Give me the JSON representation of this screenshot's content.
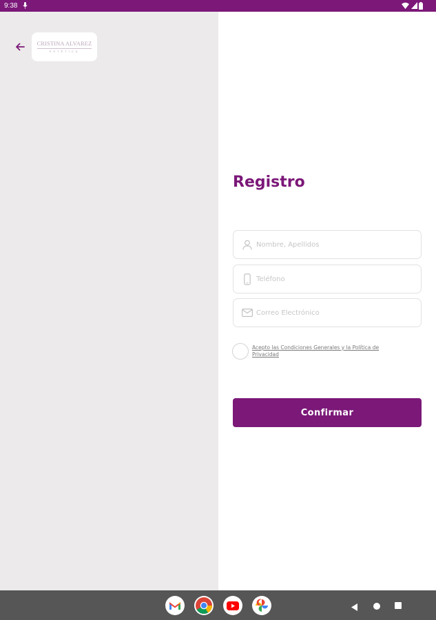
{
  "status_bar": {
    "time": "9:38",
    "icons": [
      "mic-icon",
      "wifi-icon",
      "signal-icon",
      "battery-icon"
    ]
  },
  "header": {
    "back_icon": "arrow-left-icon",
    "logo": {
      "name": "CRISTINA ALVAREZ",
      "subtitle": "ESTÉTICA"
    }
  },
  "form": {
    "title": "Registro",
    "fields": [
      {
        "icon": "person-icon",
        "placeholder": "Nombre, Apellidos",
        "value": ""
      },
      {
        "icon": "phone-icon",
        "placeholder": "Teléfono",
        "value": ""
      },
      {
        "icon": "mail-icon",
        "placeholder": "Correo Electrónico",
        "value": ""
      }
    ],
    "terms": {
      "checked": false,
      "label": "Acepto las Condiciones Generales y la Política de Privacidad"
    },
    "confirm_label": "Confirmar"
  },
  "colors": {
    "accent": "#7b1878",
    "left_panel_bg": "#eceaea",
    "nav_bar_bg": "#565656"
  },
  "nav_bar": {
    "apps": [
      "gmail-icon",
      "chrome-icon",
      "youtube-icon",
      "photos-icon"
    ],
    "buttons": [
      "back-triangle-icon",
      "home-circle-icon",
      "recents-square-icon"
    ]
  }
}
